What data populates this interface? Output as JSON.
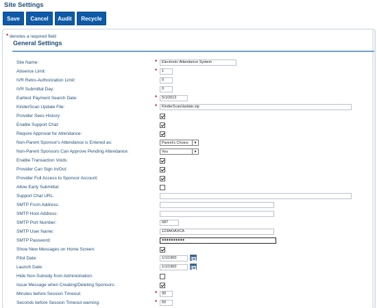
{
  "page_title": "Site Settings",
  "toolbar": {
    "save": "Save",
    "cancel": "Cancel",
    "audit": "Audit",
    "recycle": "Recycle"
  },
  "required_note": "denotes a required field",
  "section_title": "General Settings",
  "fields": {
    "site_name": {
      "label": "Site Name:",
      "value": "Electronic Attendance System"
    },
    "absence_limit": {
      "label": "Absence Limit:",
      "value": "1"
    },
    "ivr_retro": {
      "label": "IVR Retro-Authorization Limit:",
      "value": "0"
    },
    "ivr_submittal": {
      "label": "IVR Submittal Day:",
      "value": "0"
    },
    "earliest_payment": {
      "label": "Earliest Payment Search Date:",
      "value": "5/1/2012"
    },
    "kinderscan_file": {
      "label": "KinderScan Update File:",
      "value": "KinderScanUpdate.zip"
    },
    "provider_sees_history": {
      "label": "Provider Sees History:",
      "checked": true
    },
    "enable_support_chat": {
      "label": "Enable Support Chat:",
      "checked": true
    },
    "require_approval": {
      "label": "Require Approval for Attendance:",
      "checked": true
    },
    "non_parent_entered_as": {
      "label": "Non-Parent Sponsor's Attendance is Entered as:",
      "value": "Parent's Choice"
    },
    "non_parent_approve": {
      "label": "Non-Parent Sponsors Can Approve Pending Attendance:",
      "value": "Yes"
    },
    "enable_transaction_voids": {
      "label": "Enable Transaction Voids:",
      "checked": true
    },
    "provider_sign_in_out": {
      "label": "Provider Can Sign In/Out:",
      "checked": true
    },
    "provider_full_access": {
      "label": "Provider Full Access to Sponsor Account:",
      "checked": true
    },
    "allow_early_submittal": {
      "label": "Allow Early Submittal:",
      "checked": false
    },
    "support_chat_url": {
      "label": "Support Chat URL:",
      "value": ""
    },
    "smtp_from": {
      "label": "SMTP From Address:",
      "value": ""
    },
    "smtp_host": {
      "label": "SMTP Host Address:",
      "value": ""
    },
    "smtp_port": {
      "label": "SMTP Port Number:",
      "value": "587"
    },
    "smtp_user": {
      "label": "SMTP User Name:",
      "value": "123AKIAXCA"
    },
    "smtp_password": {
      "label": "SMTP Password:",
      "value": "●●●●●●●●●●"
    },
    "show_new_messages": {
      "label": "Show New Messages on Home Screen:",
      "checked": true
    },
    "pilot_date": {
      "label": "Pilot Date:",
      "value": "1/1/1900"
    },
    "launch_date": {
      "label": "Launch Date:",
      "value": "1/1/1900"
    },
    "hide_non_subsidy": {
      "label": "Hide Non-Subsidy from Administration:",
      "checked": false
    },
    "issue_message": {
      "label": "Issue Message when Creating/Deleting Sponsors:",
      "checked": true
    },
    "minutes_timeout": {
      "label": "Minutes before Session Timeout:",
      "value": "90"
    },
    "seconds_warning": {
      "label": "Seconds before Session Timeout warning:",
      "value": "50"
    }
  },
  "colors": {
    "accent": "#0e5aa7",
    "label_text": "#1f4e79",
    "required_star": "#d21c1c",
    "section_rule": "#6a9fd0"
  }
}
